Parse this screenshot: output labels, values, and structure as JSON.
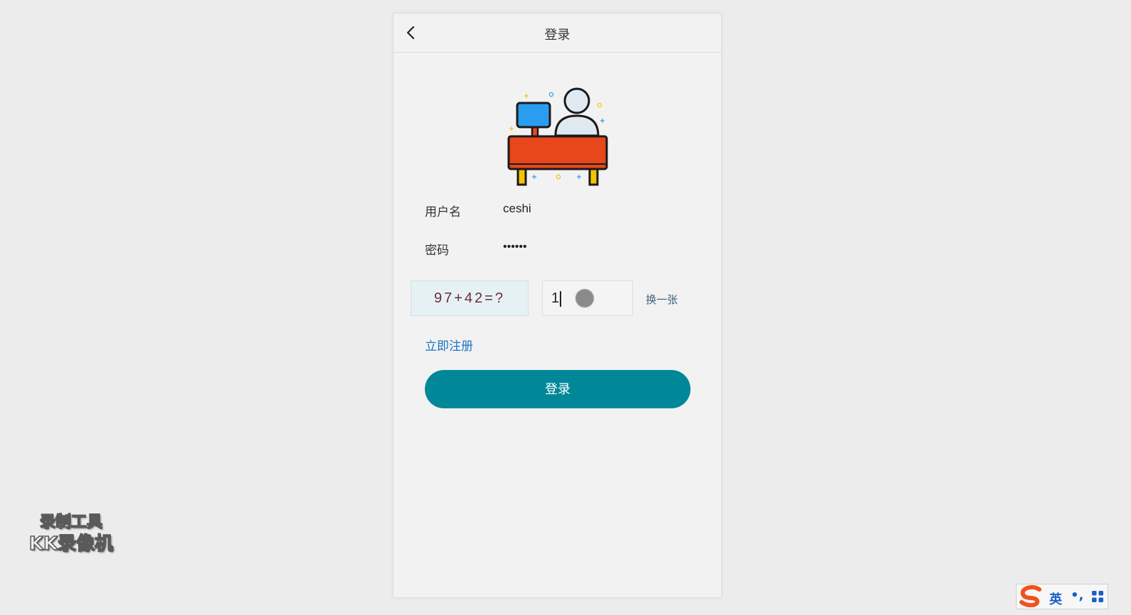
{
  "header": {
    "title": "登录"
  },
  "form": {
    "username_label": "用户名",
    "username_value": "ceshi",
    "password_label": "密码",
    "password_value": "••••••",
    "captcha_question": "97+42=?",
    "captcha_answer": "1",
    "refresh_label": "换一张",
    "register_label": "立即注册",
    "login_button_label": "登录"
  },
  "watermark": {
    "line1": "录制工具",
    "line2": "KK录像机"
  },
  "ime": {
    "mode": "英",
    "punct": "•,"
  },
  "colors": {
    "primary_button": "#008898",
    "link": "#1a73c2",
    "captcha_text": "#6b2d3a",
    "desk_orange": "#e8471b",
    "monitor_blue": "#2a9df0",
    "leg_yellow": "#f5c400"
  }
}
